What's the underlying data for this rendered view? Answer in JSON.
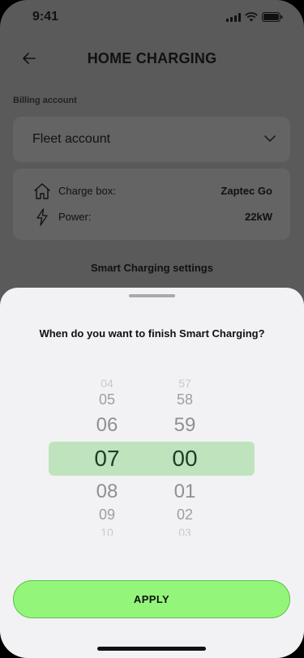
{
  "status_bar": {
    "time": "9:41"
  },
  "header": {
    "title": "HOME CHARGING"
  },
  "billing": {
    "label": "Billing account",
    "selected": "Fleet account"
  },
  "info": {
    "charge_box_label": "Charge box:",
    "charge_box_value": "Zaptec Go",
    "power_label": "Power:",
    "power_value": "22kW"
  },
  "smart_charging": {
    "title": "Smart Charging settings"
  },
  "sheet": {
    "question": "When do you want to finish Smart Charging?",
    "hours": [
      "04",
      "05",
      "06",
      "07",
      "08",
      "09",
      "10"
    ],
    "minutes": [
      "57",
      "58",
      "59",
      "00",
      "01",
      "02",
      "03"
    ],
    "selected_hour": "07",
    "selected_minute": "00",
    "apply_label": "APPLY"
  },
  "colors": {
    "accent": "#93f67b",
    "highlight": "#bfe4bd",
    "overlay": "#5a5a5a",
    "sheet": "#f2f2f4"
  }
}
